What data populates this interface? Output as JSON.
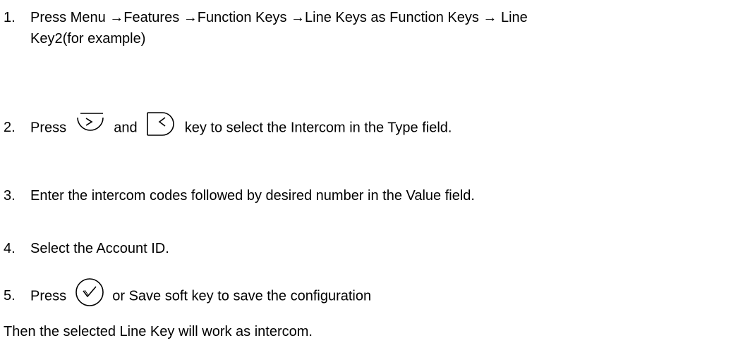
{
  "steps": [
    {
      "number": "1.",
      "line1": "Press Menu →Features →Function Keys →Line Keys as Function Keys → Line",
      "line2": "Key2(for example)"
    },
    {
      "number": "2.",
      "before": "Press",
      "between": "and",
      "after": "key to select the Intercom in the Type field.",
      "icons": [
        "right-arrow-key-icon",
        "left-arrow-key-icon"
      ]
    },
    {
      "number": "3.",
      "text": "Enter the intercom codes followed by desired number in the Value field."
    },
    {
      "number": "4.",
      "text": "Select the Account ID."
    },
    {
      "number": "5.",
      "before": "Press",
      "after": "or Save soft key to save the  configuration",
      "icons": [
        "ok-check-key-icon"
      ]
    }
  ],
  "conclusion": "Then the selected Line Key will work as  intercom."
}
